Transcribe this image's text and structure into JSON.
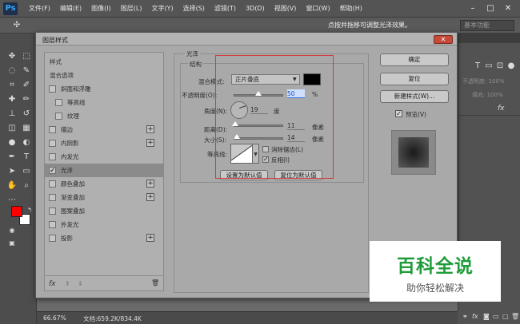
{
  "app": {
    "logo": "Ps"
  },
  "menubar": {
    "items": [
      "文件(F)",
      "编辑(E)",
      "图像(I)",
      "图层(L)",
      "文字(Y)",
      "选择(S)",
      "滤镜(T)",
      "3D(D)",
      "视图(V)",
      "窗口(W)",
      "帮助(H)"
    ],
    "min": "–",
    "max": "□",
    "close": "✕"
  },
  "options": {
    "hint": "点按并拖移可调整光泽效果。",
    "workspace": "基本功能"
  },
  "panels": {
    "opacity": "不透明度: 100%",
    "fill": "填充: 100%",
    "fx": "fx"
  },
  "status": {
    "zoom": "66.67%",
    "doc": "文档:659.2K/834.4K"
  },
  "dialog": {
    "title": "图层样式",
    "close": "✕",
    "list": [
      {
        "label": "样式",
        "type": "header"
      },
      {
        "label": "混合选项",
        "type": "header"
      },
      {
        "label": "斜面和浮雕",
        "checkbox": true,
        "checked": false,
        "bold": true
      },
      {
        "label": "等高线",
        "checkbox": true,
        "checked": false,
        "indent": true
      },
      {
        "label": "纹理",
        "checkbox": true,
        "checked": false,
        "indent": true
      },
      {
        "label": "描边",
        "checkbox": true,
        "checked": false,
        "plus": true
      },
      {
        "label": "内阴影",
        "checkbox": true,
        "checked": false,
        "plus": true
      },
      {
        "label": "内发光",
        "checkbox": true,
        "checked": false
      },
      {
        "label": "光泽",
        "checkbox": true,
        "checked": true,
        "selected": true
      },
      {
        "label": "颜色叠加",
        "checkbox": true,
        "checked": false,
        "plus": true
      },
      {
        "label": "渐变叠加",
        "checkbox": true,
        "checked": false,
        "plus": true
      },
      {
        "label": "图案叠加",
        "checkbox": true,
        "checked": false
      },
      {
        "label": "外发光",
        "checkbox": true,
        "checked": false
      },
      {
        "label": "投影",
        "checkbox": true,
        "checked": false,
        "plus": true
      }
    ],
    "footer": {
      "fx": "fx",
      "up": "⬆",
      "down": "⬇",
      "trash": "🗑"
    },
    "section_title": "光泽",
    "group_title": "结构",
    "blend_mode": {
      "label": "混合模式:",
      "value": "正片叠底",
      "color": "#000000"
    },
    "opacity": {
      "label": "不透明度(O):",
      "value": "50",
      "unit": "%",
      "level": 0.5
    },
    "angle": {
      "label": "角度(N):",
      "value": "19",
      "unit": "度"
    },
    "distance": {
      "label": "距离(D):",
      "value": "11",
      "unit": "像素",
      "level": 0.04
    },
    "size": {
      "label": "大小(S):",
      "value": "14",
      "unit": "像素",
      "level": 0.06
    },
    "contour": {
      "label": "等高线:",
      "antialias": "消除锯齿(L)",
      "invert": "反相(I)",
      "antialias_checked": false,
      "invert_checked": true
    },
    "buttons": {
      "set_default": "设置为默认值",
      "reset_default": "复位为默认值"
    },
    "right": {
      "ok": "确定",
      "reset": "复位",
      "new_style": "新建样式(W)...",
      "preview": "预览(V)",
      "preview_checked": true
    }
  },
  "watermark": {
    "title": "百科全说",
    "subtitle": "助你轻松解决"
  }
}
